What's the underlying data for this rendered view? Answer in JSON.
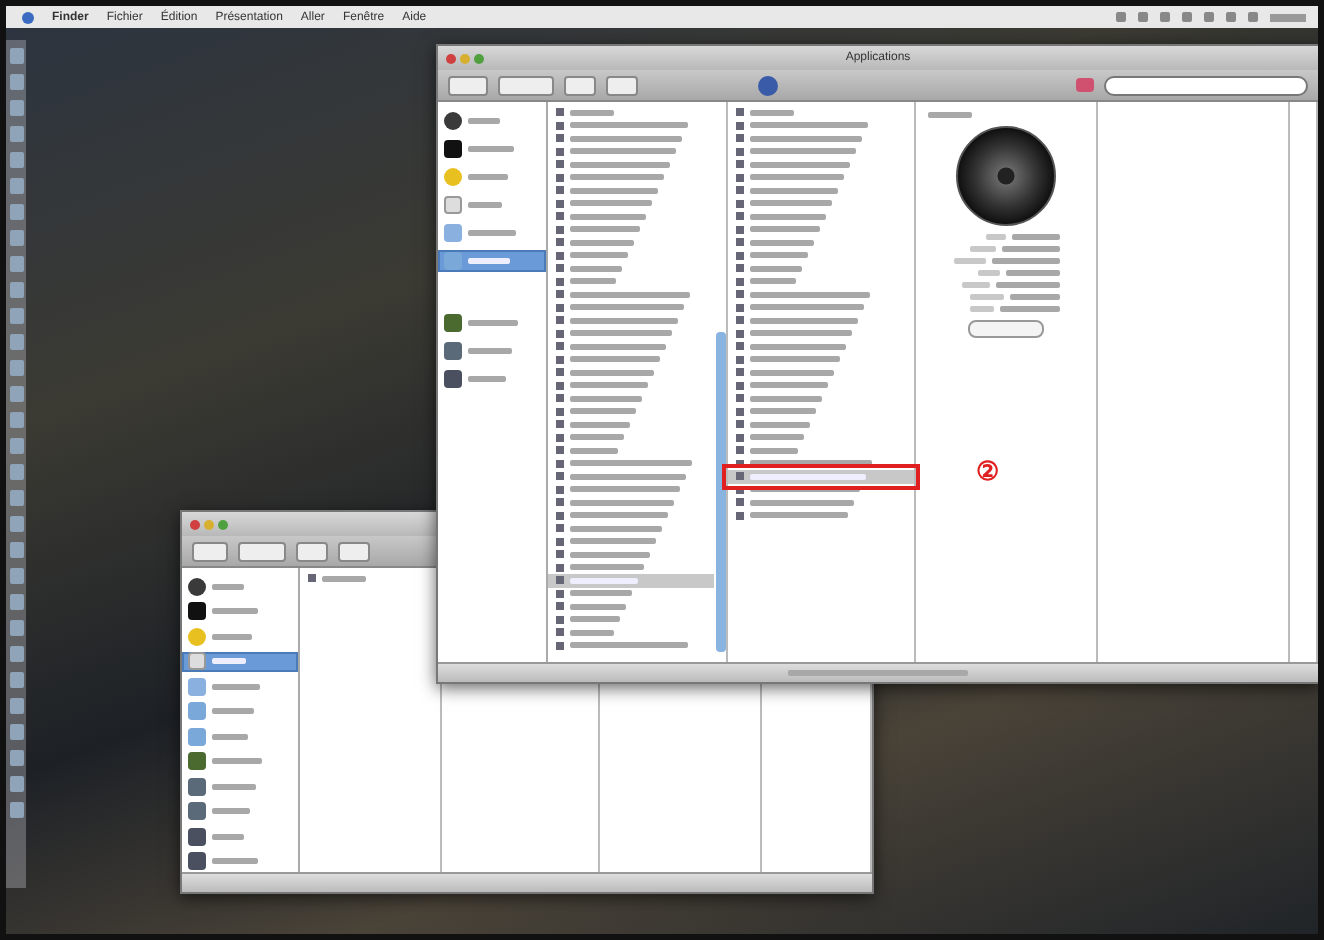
{
  "menu_bar": {
    "items": [
      {
        "label": "Finder"
      },
      {
        "label": "Fichier"
      },
      {
        "label": "Édition"
      },
      {
        "label": "Présentation"
      },
      {
        "label": "Aller"
      },
      {
        "label": "Fenêtre"
      },
      {
        "label": "Aide"
      }
    ]
  },
  "front_window": {
    "title": "Applications",
    "sidebar": [
      {
        "kind": "disk",
        "selected": false
      },
      {
        "kind": "drive",
        "selected": false
      },
      {
        "kind": "cd",
        "selected": false
      },
      {
        "kind": "volume",
        "selected": false
      },
      {
        "kind": "network",
        "selected": false
      },
      {
        "kind": "folder",
        "selected": true
      },
      {
        "kind": "gap"
      },
      {
        "kind": "movies",
        "selected": false
      },
      {
        "kind": "pictures",
        "selected": false
      },
      {
        "kind": "music",
        "selected": false
      }
    ],
    "columns": [
      {
        "rows": [
          {
            "selected": false
          },
          {
            "selected": false
          },
          {
            "selected": false
          },
          {
            "selected": false
          },
          {
            "selected": false
          },
          {
            "selected": false
          },
          {
            "selected": false
          },
          {
            "selected": false
          },
          {
            "selected": false
          },
          {
            "selected": false
          },
          {
            "selected": false
          },
          {
            "selected": false
          },
          {
            "selected": false
          },
          {
            "selected": false
          },
          {
            "selected": false
          },
          {
            "selected": false
          },
          {
            "selected": false
          },
          {
            "selected": false
          },
          {
            "selected": false
          },
          {
            "selected": false
          },
          {
            "selected": false
          },
          {
            "selected": false
          },
          {
            "selected": false
          },
          {
            "selected": false
          },
          {
            "selected": false
          },
          {
            "selected": false
          },
          {
            "selected": false
          },
          {
            "selected": false
          },
          {
            "selected": false
          },
          {
            "selected": false
          },
          {
            "selected": false
          },
          {
            "selected": false
          },
          {
            "selected": false
          },
          {
            "selected": false
          },
          {
            "selected": false
          },
          {
            "selected": false
          },
          {
            "selected": true
          },
          {
            "selected": false
          },
          {
            "selected": false
          },
          {
            "selected": false
          },
          {
            "selected": false
          },
          {
            "selected": false
          }
        ]
      },
      {
        "rows": [
          {
            "selected": false
          },
          {
            "selected": false
          },
          {
            "selected": false
          },
          {
            "selected": false
          },
          {
            "selected": false
          },
          {
            "selected": false
          },
          {
            "selected": false
          },
          {
            "selected": false
          },
          {
            "selected": false
          },
          {
            "selected": false
          },
          {
            "selected": false
          },
          {
            "selected": false
          },
          {
            "selected": false
          },
          {
            "selected": false
          },
          {
            "selected": false
          },
          {
            "selected": false
          },
          {
            "selected": false
          },
          {
            "selected": false
          },
          {
            "selected": false
          },
          {
            "selected": false
          },
          {
            "selected": false
          },
          {
            "selected": false
          },
          {
            "selected": false
          },
          {
            "selected": false
          },
          {
            "selected": false
          },
          {
            "selected": false
          },
          {
            "selected": false
          },
          {
            "selected": false
          },
          {
            "selected": true
          },
          {
            "selected": false
          },
          {
            "selected": false
          },
          {
            "selected": false
          }
        ]
      }
    ]
  },
  "back_window": {
    "sidebar": [
      {
        "kind": "disk",
        "selected": false
      },
      {
        "kind": "drive",
        "selected": false
      },
      {
        "kind": "cd",
        "selected": false
      },
      {
        "kind": "volume",
        "selected": true
      },
      {
        "kind": "network",
        "selected": false
      },
      {
        "kind": "folder",
        "selected": false
      },
      {
        "kind": "folder",
        "selected": false
      },
      {
        "kind": "movies",
        "selected": false
      },
      {
        "kind": "pictures",
        "selected": false
      },
      {
        "kind": "pictures",
        "selected": false
      },
      {
        "kind": "music",
        "selected": false
      },
      {
        "kind": "music",
        "selected": false
      }
    ],
    "rows": [
      {
        "selected": false
      }
    ]
  },
  "annotation": {
    "label": "②"
  }
}
